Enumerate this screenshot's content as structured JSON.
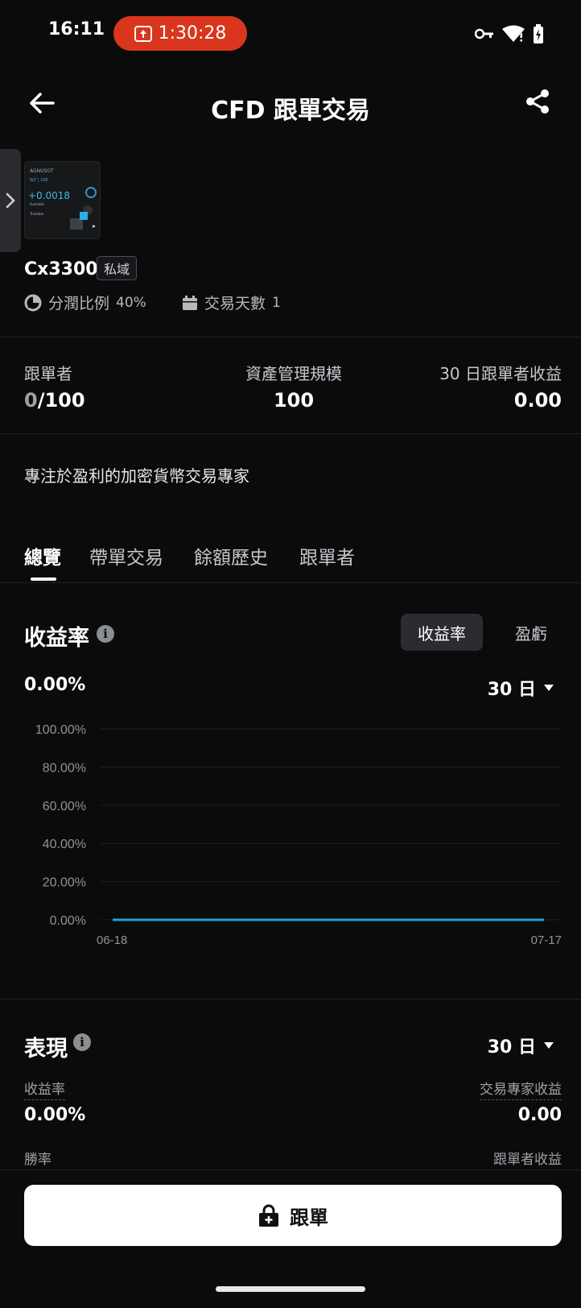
{
  "status": {
    "time": "16:11",
    "recording": "1:30:28"
  },
  "header": {
    "title": "CFD 跟單交易"
  },
  "avatar": {
    "brand": "AGNUSOT",
    "line1": "SLT | 100",
    "value": "+0.0018",
    "line2": "Available",
    "line3": "Tradable"
  },
  "trader": {
    "name": "Cx3300",
    "badge": "私域",
    "profit_share_label": "分潤比例",
    "profit_share_value": "40%",
    "days_label": "交易天數",
    "days_value": "1"
  },
  "stats": {
    "followers_label": "跟單者",
    "followers_current": "0",
    "followers_max": "/100",
    "aum_label": "資產管理規模",
    "aum_value": "100",
    "pnl30_label": "30 日跟單者收益",
    "pnl30_value": "0.00"
  },
  "bio": "專注於盈利的加密貨幣交易專家",
  "tabs": [
    {
      "label": "總覽",
      "active": true
    },
    {
      "label": "帶單交易",
      "active": false
    },
    {
      "label": "餘額歷史",
      "active": false
    },
    {
      "label": "跟單者",
      "active": false
    }
  ],
  "roi_section": {
    "title": "收益率",
    "seg_roi": "收益率",
    "seg_pnl": "盈虧",
    "current": "0.00%",
    "period": "30 日"
  },
  "chart_data": {
    "type": "line",
    "x_labels": [
      "06-18",
      "07-17"
    ],
    "y_ticks": [
      "100.00%",
      "80.00%",
      "60.00%",
      "40.00%",
      "20.00%",
      "0.00%"
    ],
    "ylim": [
      0,
      100
    ],
    "series": [
      {
        "values": [
          0,
          0
        ]
      }
    ],
    "color": "#1ea2d8",
    "grid": true
  },
  "performance": {
    "title": "表現",
    "period": "30 日",
    "roi_label": "收益率",
    "roi_value": "0.00%",
    "expert_pnl_label": "交易專家收益",
    "expert_pnl_value": "0.00",
    "winrate_label": "勝率",
    "follower_pnl_label": "跟單者收益"
  },
  "cta": {
    "label": "跟單"
  }
}
